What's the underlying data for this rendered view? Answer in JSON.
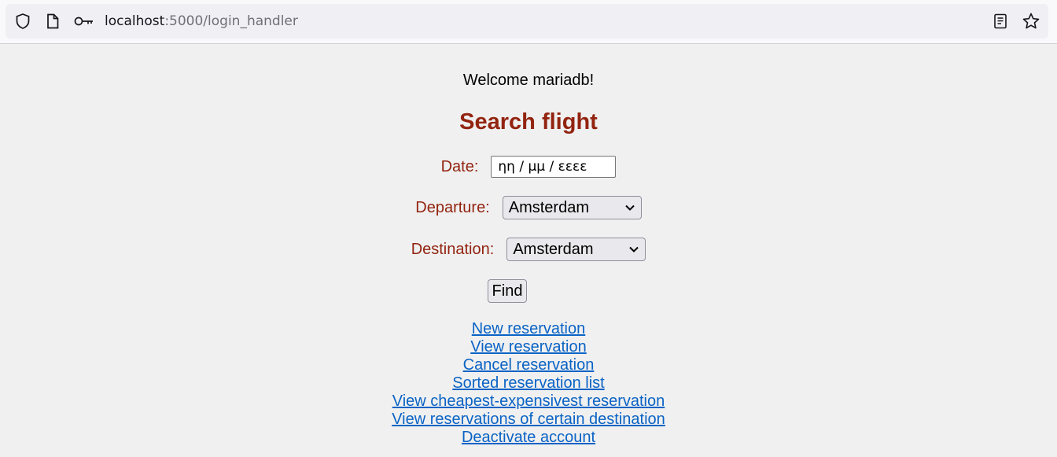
{
  "browser": {
    "url_host": "localhost",
    "url_path": ":5000/login_handler",
    "icons": [
      "shield-icon",
      "page-icon",
      "key-icon",
      "reader-view-icon",
      "bookmark-star-icon"
    ]
  },
  "page": {
    "welcome": "Welcome mariadb!",
    "heading": "Search flight",
    "form": {
      "date_label": "Date:",
      "date_placeholder": "ηη / μμ / εεεε",
      "departure_label": "Departure:",
      "departure_value": "Amsterdam",
      "destination_label": "Destination:",
      "destination_value": "Amsterdam",
      "find_label": "Find"
    },
    "links": [
      "New reservation",
      "View reservation",
      "Cancel reservation",
      "Sorted reservation list",
      "View cheapest-expensivest reservation",
      "View reservations of certain destination",
      "Deactivate account"
    ]
  },
  "colors": {
    "heading": "#922410",
    "link": "#0a63c5",
    "background": "#f0f0f0"
  }
}
